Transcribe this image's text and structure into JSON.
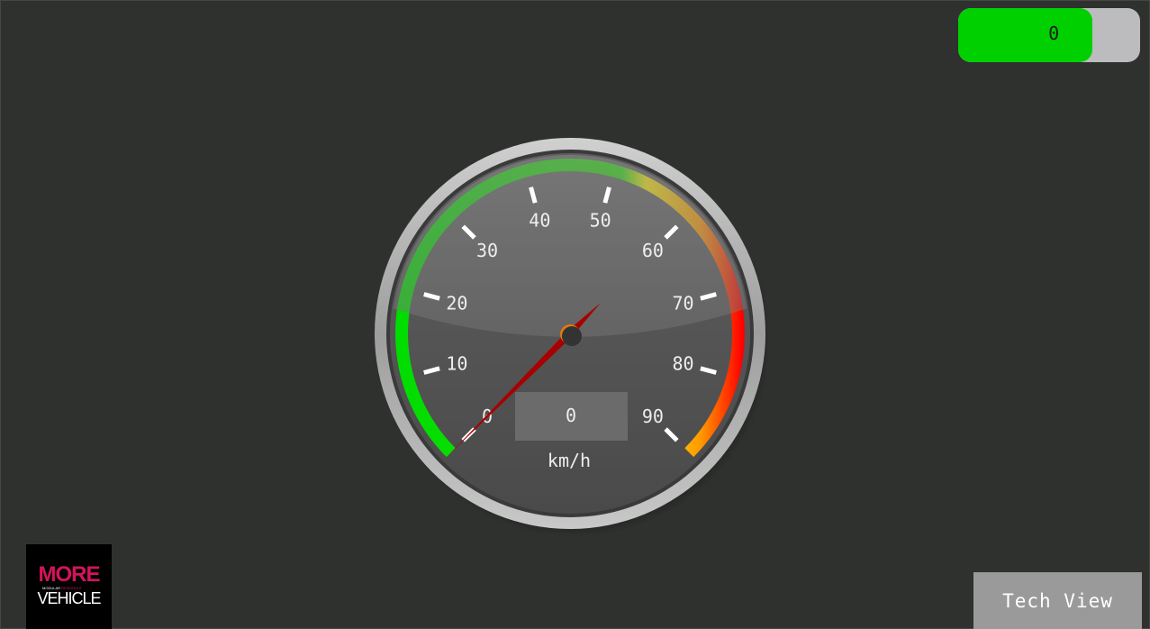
{
  "toggle": {
    "value": "0",
    "fill_fraction": 0.74,
    "fill_color": "#00d000"
  },
  "speedometer": {
    "min": 0,
    "max": 90,
    "ticks": [
      "0",
      "10",
      "20",
      "30",
      "40",
      "50",
      "60",
      "70",
      "80",
      "90"
    ],
    "speed_value": "0",
    "unit": "km/h",
    "needle_value": 0,
    "arc_colors": [
      "#00dd00",
      "#ffee00",
      "#ff9900",
      "#ff0000"
    ]
  },
  "logo": {
    "line1": "MORE",
    "line2_left": "MODULAR",
    "line2_right": "RESEARCH",
    "line3": "VEHICLE",
    "accent": "#d4145a"
  },
  "tech_view_button": {
    "label": "Tech View"
  }
}
